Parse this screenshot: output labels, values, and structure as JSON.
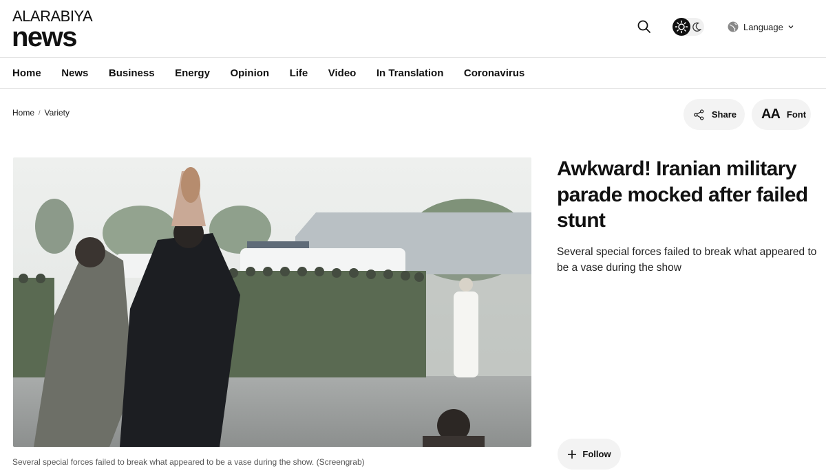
{
  "brand": {
    "top": "ALARABIYA",
    "bottom": "news"
  },
  "header": {
    "language_label": "Language"
  },
  "nav": {
    "items": [
      "Home",
      "News",
      "Business",
      "Energy",
      "Opinion",
      "Life",
      "Video",
      "In Translation",
      "Coronavirus"
    ]
  },
  "breadcrumb": {
    "home": "Home",
    "section": "Variety",
    "separator": "/"
  },
  "actions": {
    "share": "Share",
    "font": "Font",
    "font_glyph": "AA"
  },
  "article": {
    "headline": "Awkward! Iranian military parade mocked after failed stunt",
    "subheadline": "Several special forces failed to break what appeared to be a vase during the show",
    "image_caption": "Several special forces failed to break what appeared to be a vase during the show. (Screengrab)",
    "follow_label": "Follow"
  },
  "icons": {
    "search": "search-icon",
    "sun": "sun-icon",
    "moon": "moon-icon",
    "globe": "globe-icon",
    "chevron": "chevron-down-icon",
    "share": "share-icon",
    "plus": "plus-icon"
  },
  "colors": {
    "text": "#111111",
    "pill_bg": "#f3f3f3",
    "divider": "#e3e3e3"
  }
}
